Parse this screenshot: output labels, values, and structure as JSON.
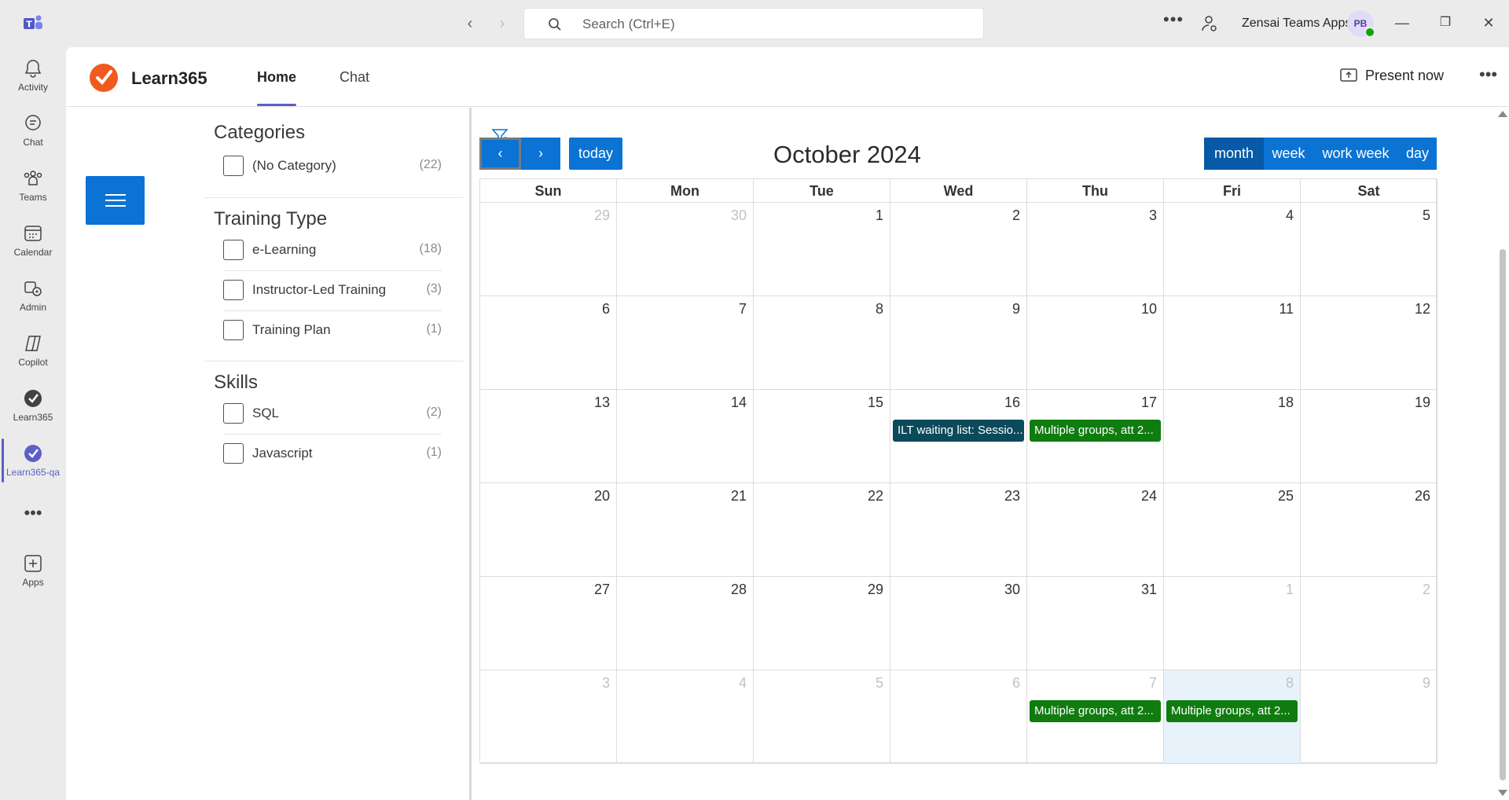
{
  "titlebar": {
    "search_placeholder": "Search (Ctrl+E)",
    "org_name": "Zensai Teams Apps",
    "avatar_initials": "PB"
  },
  "rail": {
    "items": [
      {
        "label": "Activity",
        "icon": "bell-icon"
      },
      {
        "label": "Chat",
        "icon": "chat-icon"
      },
      {
        "label": "Teams",
        "icon": "teams-icon"
      },
      {
        "label": "Calendar",
        "icon": "calendar-icon"
      },
      {
        "label": "Admin",
        "icon": "admin-icon"
      },
      {
        "label": "Copilot",
        "icon": "copilot-icon"
      },
      {
        "label": "Learn365",
        "icon": "learn365-icon"
      },
      {
        "label": "Learn365-qa",
        "icon": "learn365-icon"
      },
      {
        "label": "Apps",
        "icon": "plus-icon"
      }
    ],
    "more": "•••"
  },
  "app": {
    "name": "Learn365",
    "tabs": [
      {
        "label": "Home"
      },
      {
        "label": "Chat"
      }
    ],
    "present_label": "Present now",
    "more": "•••"
  },
  "filters": {
    "sections": [
      {
        "title": "Categories",
        "items": [
          {
            "name": "(No Category)",
            "count": "(22)"
          }
        ]
      },
      {
        "title": "Training Type",
        "items": [
          {
            "name": "e-Learning",
            "count": "(18)"
          },
          {
            "name": "Instructor-Led Training",
            "count": "(3)"
          },
          {
            "name": "Training Plan",
            "count": "(1)"
          }
        ]
      },
      {
        "title": "Skills",
        "items": [
          {
            "name": "SQL",
            "count": "(2)"
          },
          {
            "name": "Javascript",
            "count": "(1)"
          }
        ]
      }
    ]
  },
  "calendar": {
    "prev": "‹",
    "next": "›",
    "today_label": "today",
    "title": "October 2024",
    "views": [
      {
        "label": "month",
        "selected": true
      },
      {
        "label": "week",
        "selected": false
      },
      {
        "label": "work week",
        "selected": false
      },
      {
        "label": "day",
        "selected": false
      }
    ],
    "weekdays": [
      "Sun",
      "Mon",
      "Tue",
      "Wed",
      "Thu",
      "Fri",
      "Sat"
    ],
    "weeks": [
      [
        {
          "d": "29",
          "other": true
        },
        {
          "d": "30",
          "other": true
        },
        {
          "d": "1"
        },
        {
          "d": "2"
        },
        {
          "d": "3"
        },
        {
          "d": "4"
        },
        {
          "d": "5"
        }
      ],
      [
        {
          "d": "6"
        },
        {
          "d": "7"
        },
        {
          "d": "8"
        },
        {
          "d": "9"
        },
        {
          "d": "10"
        },
        {
          "d": "11"
        },
        {
          "d": "12"
        }
      ],
      [
        {
          "d": "13"
        },
        {
          "d": "14"
        },
        {
          "d": "15"
        },
        {
          "d": "16"
        },
        {
          "d": "17"
        },
        {
          "d": "18"
        },
        {
          "d": "19"
        }
      ],
      [
        {
          "d": "20"
        },
        {
          "d": "21"
        },
        {
          "d": "22"
        },
        {
          "d": "23"
        },
        {
          "d": "24"
        },
        {
          "d": "25"
        },
        {
          "d": "26"
        }
      ],
      [
        {
          "d": "27"
        },
        {
          "d": "28"
        },
        {
          "d": "29"
        },
        {
          "d": "30"
        },
        {
          "d": "31"
        },
        {
          "d": "1",
          "other": true
        },
        {
          "d": "2",
          "other": true
        }
      ],
      [
        {
          "d": "3",
          "other": true
        },
        {
          "d": "4",
          "other": true
        },
        {
          "d": "5",
          "other": true
        },
        {
          "d": "6",
          "other": true
        },
        {
          "d": "7",
          "other": true
        },
        {
          "d": "8",
          "other": true,
          "today": true
        },
        {
          "d": "9",
          "other": true
        }
      ]
    ],
    "events": [
      {
        "week": 2,
        "day": 3,
        "title": "ILT waiting list: Sessio...",
        "color": "#0b4a5b"
      },
      {
        "week": 2,
        "day": 4,
        "title": "Multiple groups, att 2...",
        "color": "#107c10"
      },
      {
        "week": 5,
        "day": 4,
        "title": "Multiple groups, att 2...",
        "color": "#107c10"
      },
      {
        "week": 5,
        "day": 5,
        "title": "Multiple groups, att 2...",
        "color": "#107c10"
      }
    ]
  },
  "colors": {
    "accent": "#0a73d4",
    "teams_purple": "#5b5fc7"
  }
}
